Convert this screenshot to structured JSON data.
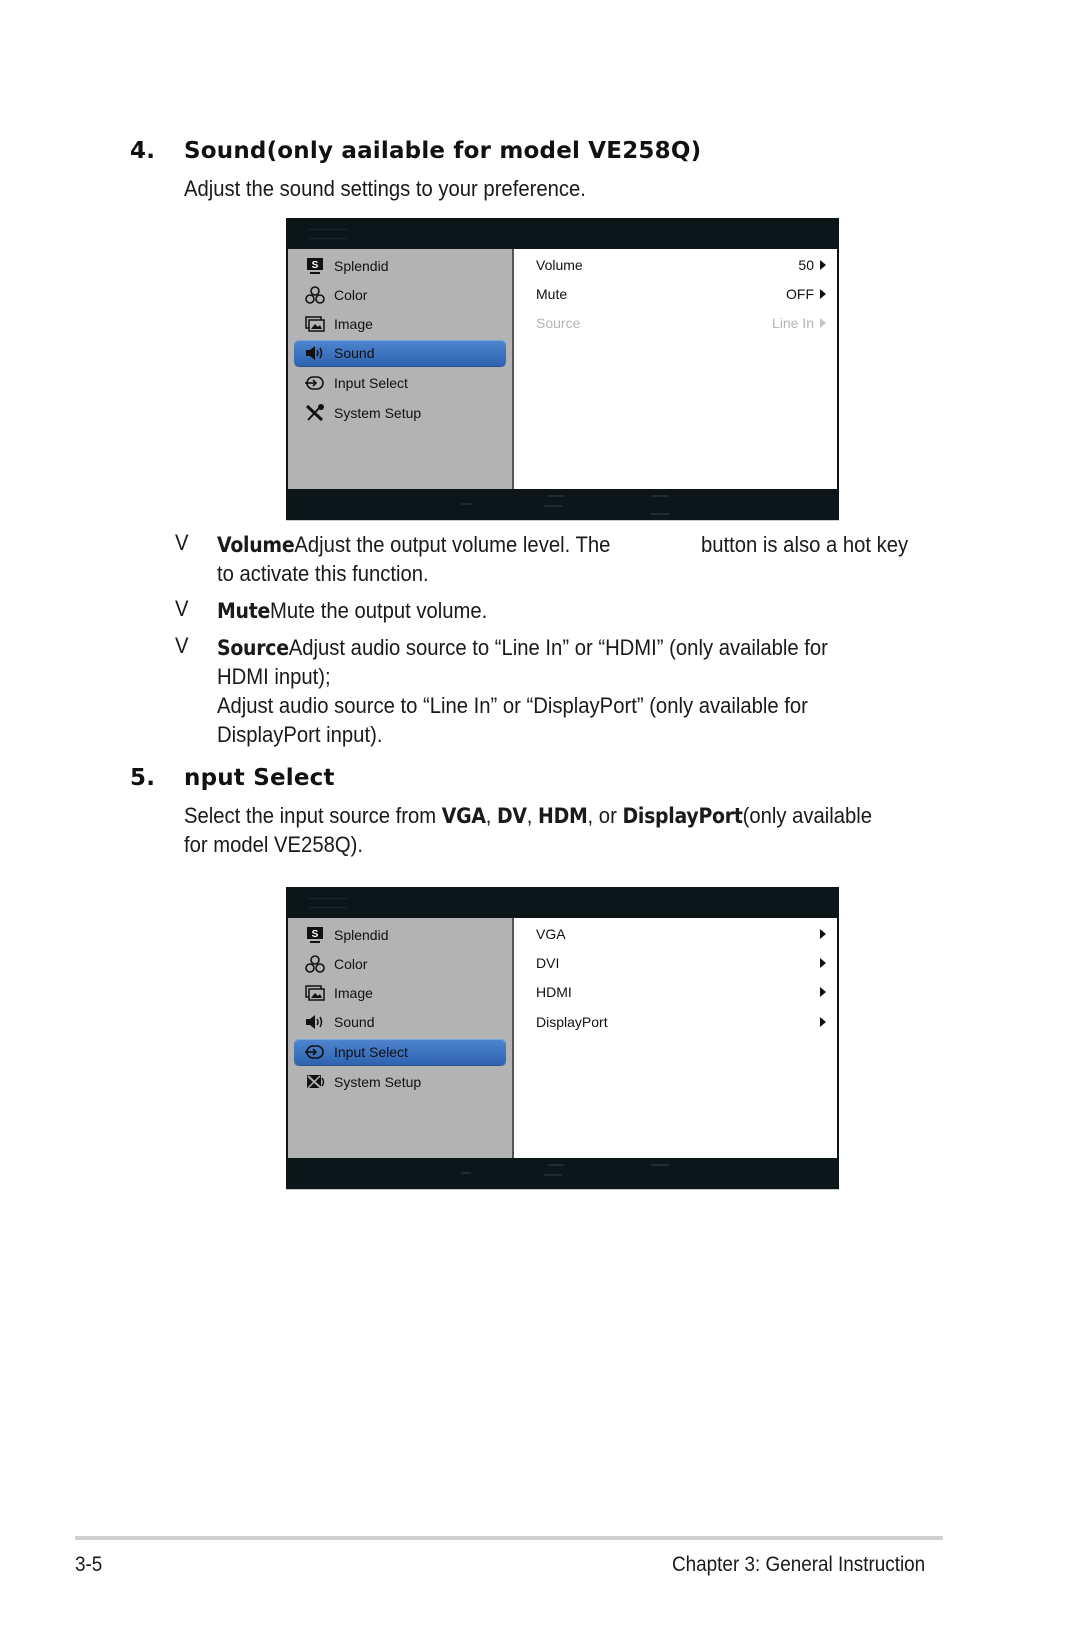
{
  "section4": {
    "number": "4.",
    "title": "Sound(only aailable for model VE258Q)",
    "intro": "Adjust the sound settings to your preference.",
    "osd": {
      "menu": [
        {
          "label": "Splendid",
          "icon": "splendid-icon"
        },
        {
          "label": "Color",
          "icon": "color-icon"
        },
        {
          "label": "Image",
          "icon": "image-icon"
        },
        {
          "label": "Sound",
          "icon": "sound-icon",
          "selected": true
        },
        {
          "label": "Input Select",
          "icon": "input-select-icon"
        },
        {
          "label": "System Setup",
          "icon": "system-setup-icon"
        }
      ],
      "options": [
        {
          "label": "Volume",
          "value": "50",
          "disabled": false
        },
        {
          "label": "Mute",
          "value": "OFF",
          "disabled": false
        },
        {
          "label": "Source",
          "value": "Line In",
          "disabled": true
        }
      ]
    },
    "bullets": [
      {
        "mark": "V",
        "keyword": "Volume",
        "text": "Adjust the output volume level. The",
        "text_after_gap": "button is also a hot key",
        "continuation": "to activate this function."
      },
      {
        "mark": "V",
        "keyword": "Mute",
        "text": "Mute the output volume."
      },
      {
        "mark": "V",
        "keyword": "Source",
        "text": "Adjust audio source to “Line In” or “HDMI”  (only available for",
        "line2": "HDMI input);",
        "line3": "Adjust audio source to “Line In” or “DisplayPort” (only available for",
        "line4": "DisplayPort input)."
      }
    ]
  },
  "section5": {
    "number": "5.",
    "title": "nput Select",
    "intro_prefix": "Select the input source from ",
    "intro_vga": "VGA",
    "intro_sep1": ", ",
    "intro_dvi": "DV",
    "intro_sep2": ", ",
    "intro_hdmi": "HDM",
    "intro_sep3": ", or ",
    "intro_dp": "DisplayPort",
    "intro_suffix": "(only available",
    "intro_line2": "for model VE258Q).",
    "osd": {
      "menu": [
        {
          "label": "Splendid",
          "icon": "splendid-icon"
        },
        {
          "label": "Color",
          "icon": "color-icon"
        },
        {
          "label": "Image",
          "icon": "image-icon"
        },
        {
          "label": "Sound",
          "icon": "sound-icon"
        },
        {
          "label": "Input Select",
          "icon": "input-select-icon",
          "selected": true
        },
        {
          "label": "System Setup",
          "icon": "system-setup-icon"
        }
      ],
      "options": [
        {
          "label": "VGA"
        },
        {
          "label": "DVI"
        },
        {
          "label": "HDMI"
        },
        {
          "label": "DisplayPort"
        }
      ]
    }
  },
  "footer": {
    "page_number": "3-5",
    "chapter": "Chapter 3: General Instruction"
  },
  "colors": {
    "osd_frame": "#0c1618",
    "menu_panel": "#b3b3b3",
    "selection": "#3a6fbf",
    "disabled_text": "#b5b5b5"
  }
}
